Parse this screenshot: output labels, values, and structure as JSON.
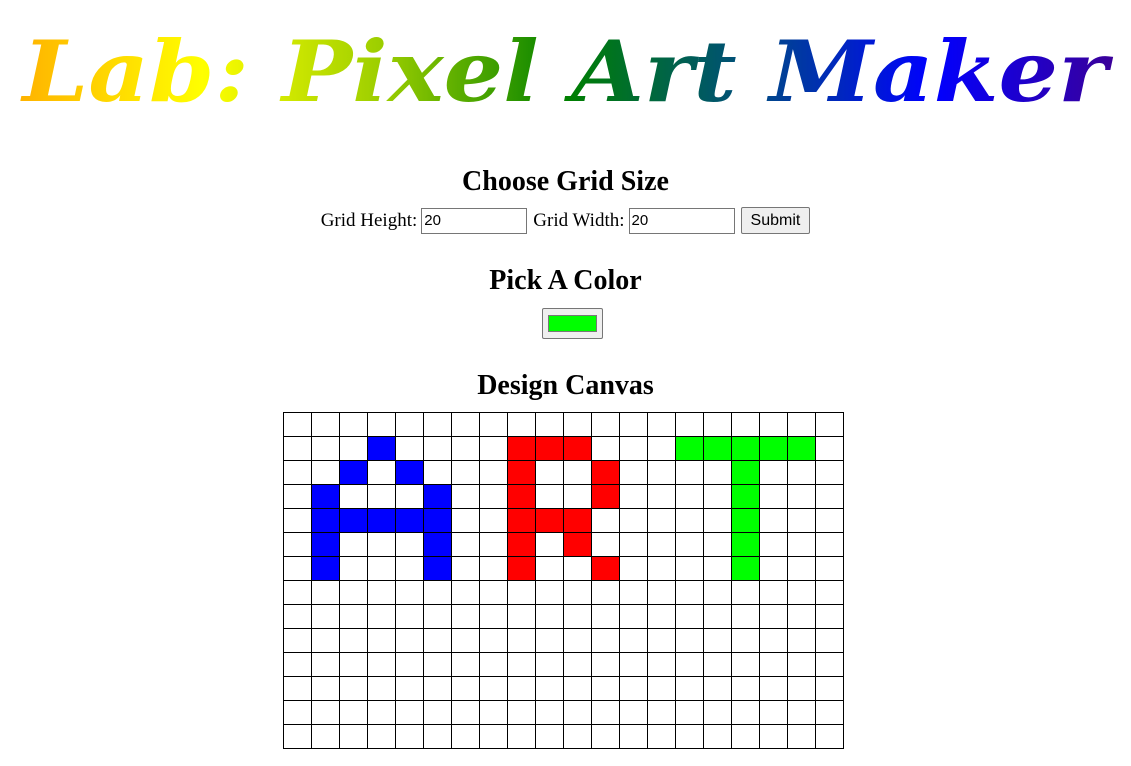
{
  "title": {
    "text": "Lab: Pixel Art Maker",
    "gradient_colors": [
      "#ffb300",
      "#ffff00",
      "#9acd00",
      "#008000",
      "#004d80",
      "#0000ff",
      "#3b0099"
    ]
  },
  "grid_size_section": {
    "heading": "Choose Grid Size",
    "height_label": "Grid Height:",
    "height_value": "20",
    "width_label": "Grid Width:",
    "width_value": "20",
    "submit_label": "Submit"
  },
  "color_section": {
    "heading": "Pick A Color",
    "selected_color": "#00ff00"
  },
  "canvas_section": {
    "heading": "Design Canvas",
    "columns": 20,
    "visible_rows": 14,
    "painted_cells": [
      {
        "row": 1,
        "col": 3,
        "color": "#0000ff"
      },
      {
        "row": 2,
        "col": 2,
        "color": "#0000ff"
      },
      {
        "row": 2,
        "col": 4,
        "color": "#0000ff"
      },
      {
        "row": 3,
        "col": 1,
        "color": "#0000ff"
      },
      {
        "row": 3,
        "col": 5,
        "color": "#0000ff"
      },
      {
        "row": 4,
        "col": 1,
        "color": "#0000ff"
      },
      {
        "row": 4,
        "col": 2,
        "color": "#0000ff"
      },
      {
        "row": 4,
        "col": 3,
        "color": "#0000ff"
      },
      {
        "row": 4,
        "col": 4,
        "color": "#0000ff"
      },
      {
        "row": 4,
        "col": 5,
        "color": "#0000ff"
      },
      {
        "row": 5,
        "col": 1,
        "color": "#0000ff"
      },
      {
        "row": 5,
        "col": 5,
        "color": "#0000ff"
      },
      {
        "row": 6,
        "col": 1,
        "color": "#0000ff"
      },
      {
        "row": 6,
        "col": 5,
        "color": "#0000ff"
      },
      {
        "row": 1,
        "col": 8,
        "color": "#ff0000"
      },
      {
        "row": 1,
        "col": 9,
        "color": "#ff0000"
      },
      {
        "row": 1,
        "col": 10,
        "color": "#ff0000"
      },
      {
        "row": 2,
        "col": 8,
        "color": "#ff0000"
      },
      {
        "row": 2,
        "col": 11,
        "color": "#ff0000"
      },
      {
        "row": 3,
        "col": 8,
        "color": "#ff0000"
      },
      {
        "row": 3,
        "col": 11,
        "color": "#ff0000"
      },
      {
        "row": 4,
        "col": 8,
        "color": "#ff0000"
      },
      {
        "row": 4,
        "col": 9,
        "color": "#ff0000"
      },
      {
        "row": 4,
        "col": 10,
        "color": "#ff0000"
      },
      {
        "row": 5,
        "col": 8,
        "color": "#ff0000"
      },
      {
        "row": 5,
        "col": 10,
        "color": "#ff0000"
      },
      {
        "row": 6,
        "col": 8,
        "color": "#ff0000"
      },
      {
        "row": 6,
        "col": 11,
        "color": "#ff0000"
      },
      {
        "row": 1,
        "col": 14,
        "color": "#00ff00"
      },
      {
        "row": 1,
        "col": 15,
        "color": "#00ff00"
      },
      {
        "row": 1,
        "col": 16,
        "color": "#00ff00"
      },
      {
        "row": 1,
        "col": 17,
        "color": "#00ff00"
      },
      {
        "row": 1,
        "col": 18,
        "color": "#00ff00"
      },
      {
        "row": 2,
        "col": 16,
        "color": "#00ff00"
      },
      {
        "row": 3,
        "col": 16,
        "color": "#00ff00"
      },
      {
        "row": 4,
        "col": 16,
        "color": "#00ff00"
      },
      {
        "row": 5,
        "col": 16,
        "color": "#00ff00"
      },
      {
        "row": 6,
        "col": 16,
        "color": "#00ff00"
      }
    ]
  }
}
